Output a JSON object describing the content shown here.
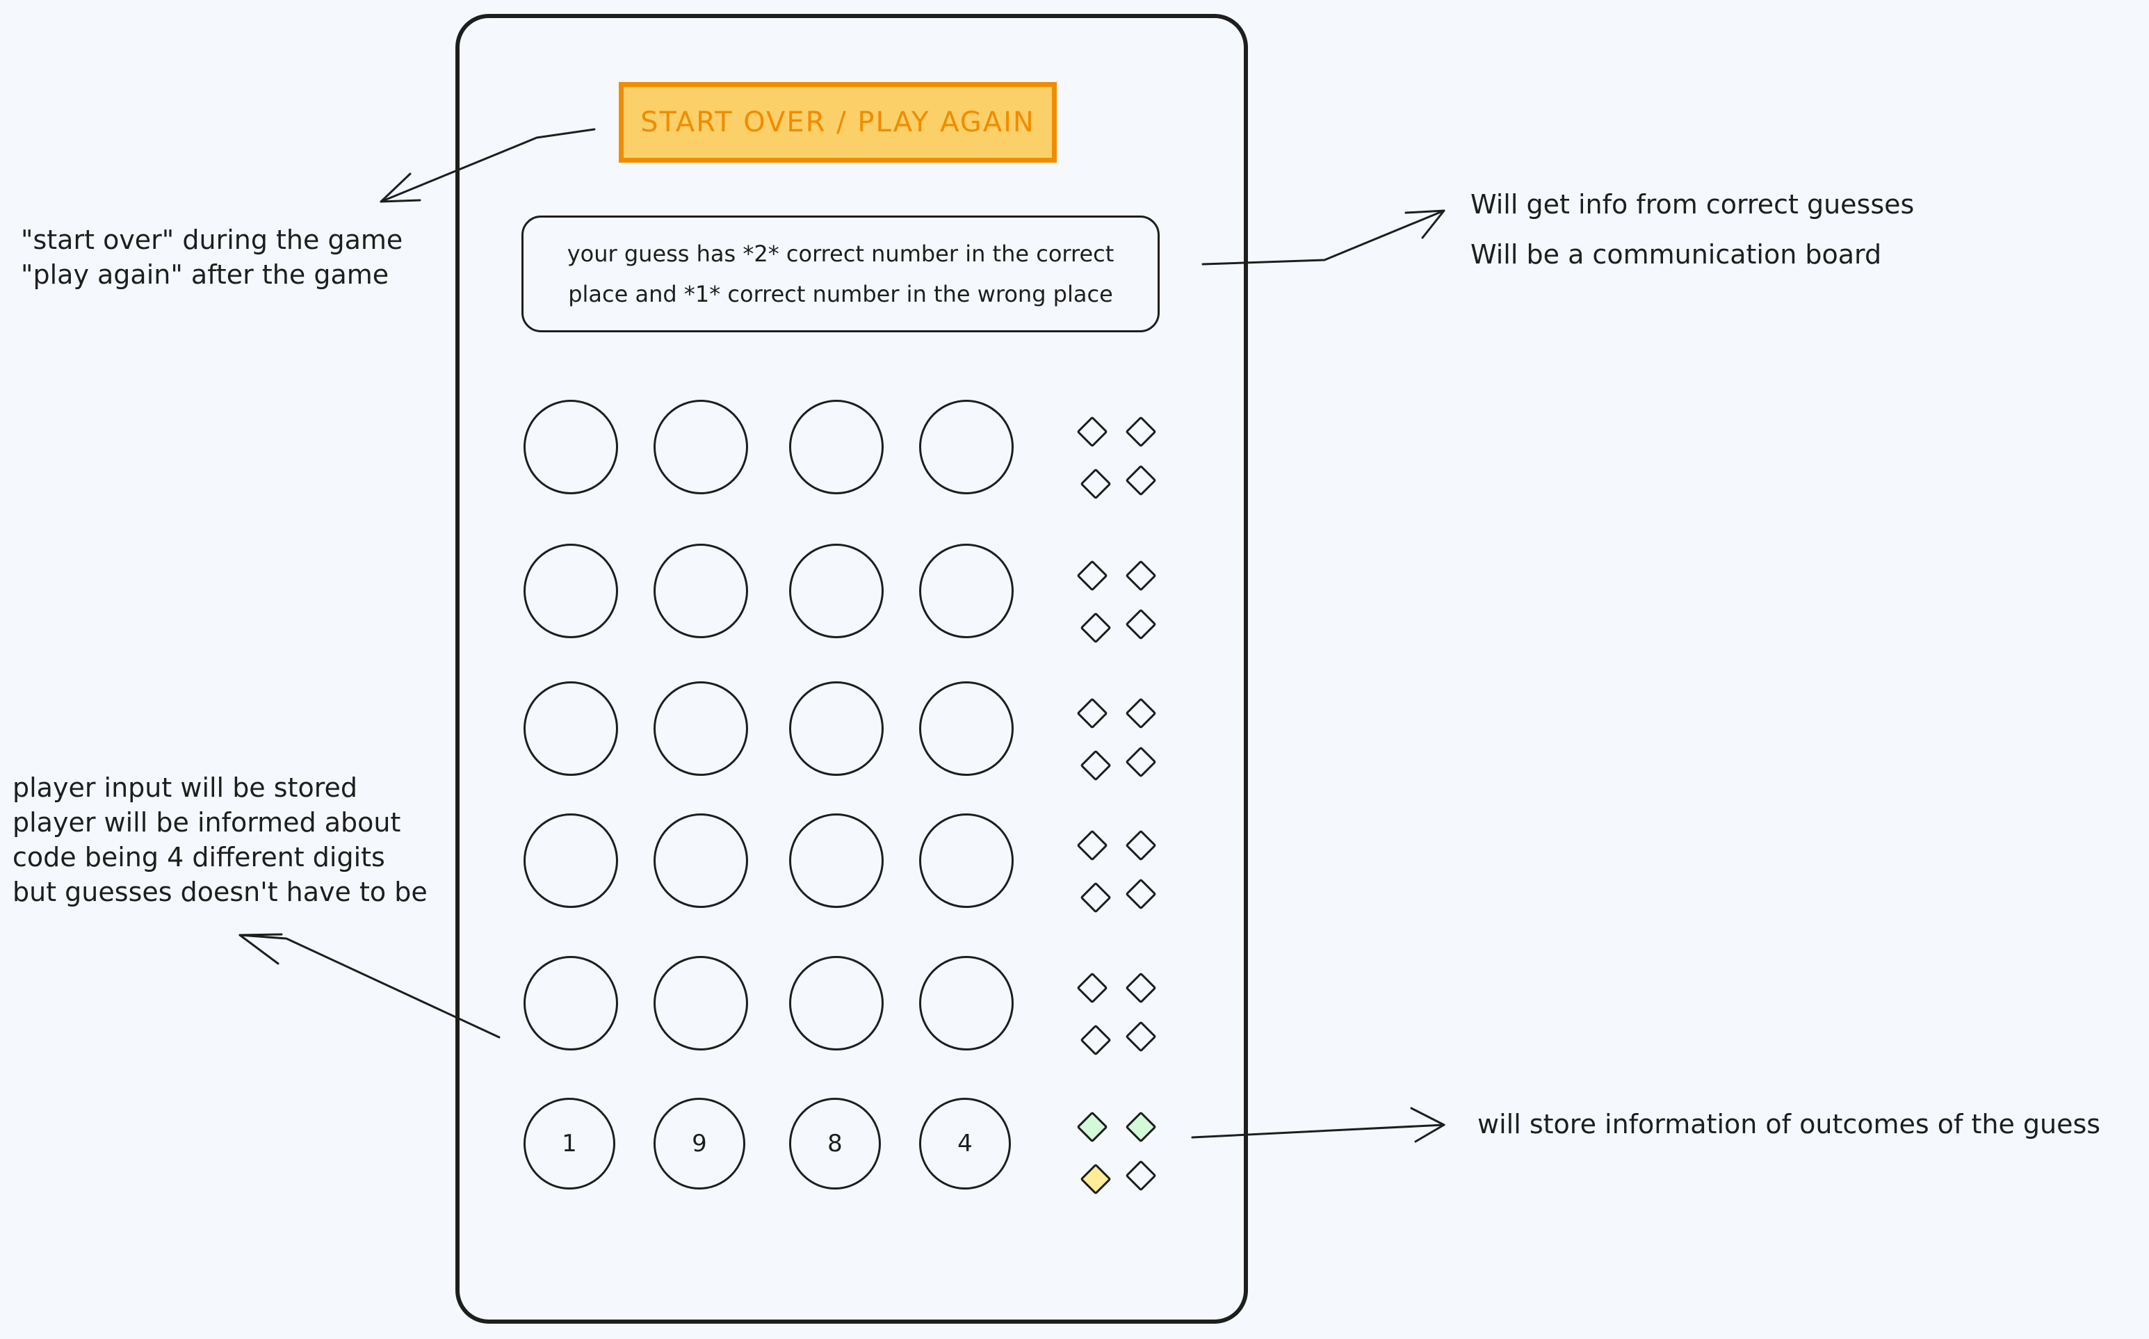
{
  "start_button": {
    "label": "START OVER / PLAY AGAIN",
    "fill": "#fcd068",
    "stroke": "#f08c00"
  },
  "communication_board": {
    "line1": "your guess has *2* correct number in the correct",
    "line2": "place and *1* correct number in the wrong place"
  },
  "annotations": {
    "start_button_note": [
      "\"start over\" during the game",
      "\"play again\" after the game"
    ],
    "board_note": [
      "Will get info from correct guesses",
      "Will be a communication board"
    ],
    "input_note": [
      "player input will be stored",
      "player will be informed about",
      "code being 4 different digits",
      "but guesses doesn't have to be"
    ],
    "outcome_note": [
      "will store information of outcomes of the guess"
    ]
  },
  "guess_rows": [
    {
      "digits": [
        "",
        "",
        "",
        ""
      ],
      "feedback": [
        "empty",
        "empty",
        "empty",
        "empty"
      ]
    },
    {
      "digits": [
        "",
        "",
        "",
        ""
      ],
      "feedback": [
        "empty",
        "empty",
        "empty",
        "empty"
      ]
    },
    {
      "digits": [
        "",
        "",
        "",
        ""
      ],
      "feedback": [
        "empty",
        "empty",
        "empty",
        "empty"
      ]
    },
    {
      "digits": [
        "",
        "",
        "",
        ""
      ],
      "feedback": [
        "empty",
        "empty",
        "empty",
        "empty"
      ]
    },
    {
      "digits": [
        "",
        "",
        "",
        ""
      ],
      "feedback": [
        "empty",
        "empty",
        "empty",
        "empty"
      ]
    },
    {
      "digits": [
        "1",
        "9",
        "8",
        "4"
      ],
      "feedback": [
        "correct-place",
        "correct-place",
        "wrong-place",
        "empty"
      ]
    }
  ],
  "feedback_colors": {
    "correct-place": "#d3f9d8",
    "wrong-place": "#ffec99",
    "empty": "transparent"
  }
}
